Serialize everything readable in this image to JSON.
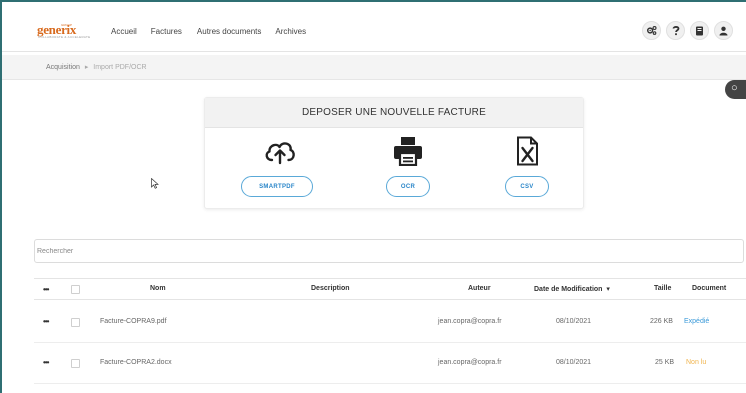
{
  "brand": {
    "logo_text": "generix",
    "logo_tag": "GROUP",
    "logo_sub": "COLLABORATE & ACCELERATE",
    "accent_color": "#d86a1e"
  },
  "nav": {
    "items": [
      {
        "label": "Accueil"
      },
      {
        "label": "Factures"
      },
      {
        "label": "Autres documents"
      },
      {
        "label": "Archives"
      }
    ]
  },
  "header_icons": [
    {
      "name": "settings-cogs-icon"
    },
    {
      "name": "help-icon"
    },
    {
      "name": "book-icon"
    },
    {
      "name": "user-icon"
    }
  ],
  "breadcrumb": {
    "parent": "Acquisition",
    "separator": "▸",
    "current": "Import PDF/OCR"
  },
  "upload": {
    "title": "DEPOSER UNE NOUVELLE FACTURE",
    "options": [
      {
        "label": "SMARTPDF",
        "icon": "cloud-upload-icon"
      },
      {
        "label": "OCR",
        "icon": "printer-icon"
      },
      {
        "label": "CSV",
        "icon": "excel-file-icon"
      }
    ],
    "button_color": "#2a86c9"
  },
  "search": {
    "placeholder": "Rechercher"
  },
  "table": {
    "columns": {
      "actions": "•••",
      "name": "Nom",
      "description": "Description",
      "author": "Auteur",
      "modified": "Date de Modification",
      "sort_indicator": "▾",
      "size": "Taille",
      "document": "Document"
    },
    "rows": [
      {
        "actions": "•••",
        "name": "Facture-COPRA9.pdf",
        "description": "",
        "author": "jean.copra@copra.fr",
        "modified": "08/10/2021",
        "size": "226 KB",
        "status": "Expédié",
        "status_color": "#3b9ad9"
      },
      {
        "actions": "•••",
        "name": "Facture-COPRA2.docx",
        "description": "",
        "author": "jean.copra@copra.fr",
        "modified": "08/10/2021",
        "size": "25 KB",
        "status": "Non lu",
        "status_color": "#f0b44c"
      }
    ]
  }
}
